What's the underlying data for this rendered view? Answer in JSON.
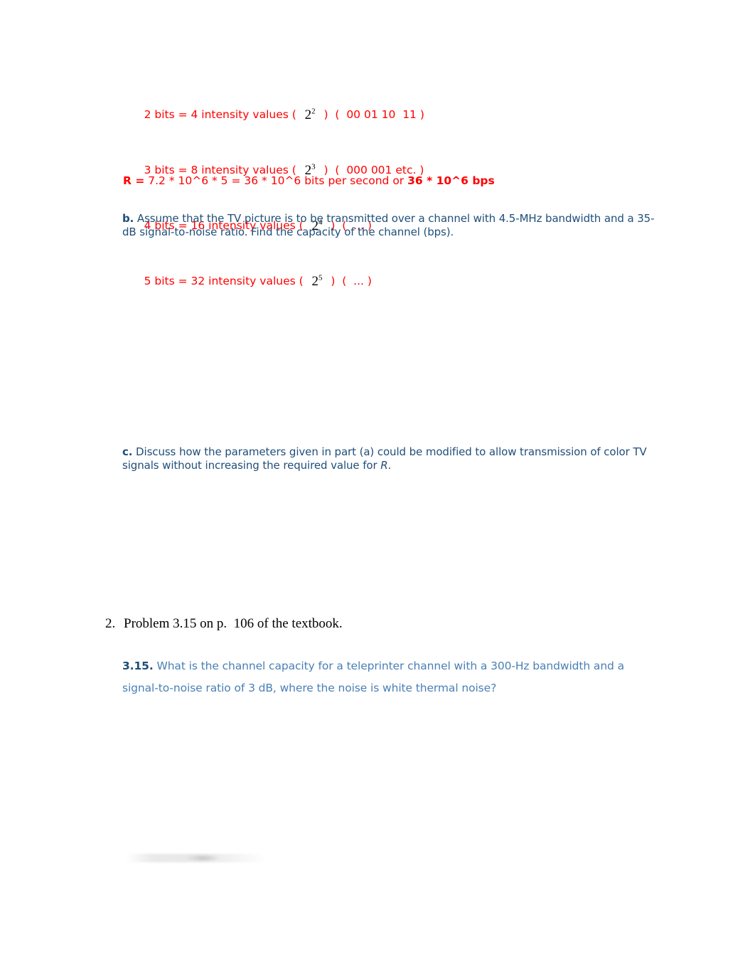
{
  "document": {
    "page_background": "#ffffff",
    "colors": {
      "annotation_red": "#ff0000",
      "textbook_blue_dark": "#1f4e79",
      "textbook_blue_light": "#4a7fb5",
      "body_black": "#000000"
    }
  },
  "red_solution": {
    "lines": [
      {
        "prefix": "2 bits = 4 intensity values (  ",
        "base": "2",
        "exp": "2",
        "suffix": "  )  (  00 01 10  11 )"
      },
      {
        "prefix": "3 bits = 8 intensity values (  ",
        "base": "2",
        "exp": "3",
        "suffix": "  )  (  000 001 etc. )"
      },
      {
        "prefix": "4 bits = 16 intensity values (  ",
        "base": "2",
        "exp": "4",
        "suffix": "  )  (  ... )"
      },
      {
        "prefix": "5 bits = 32 intensity values (  ",
        "base": "2",
        "exp": "5",
        "suffix": "  )  (  ... )"
      }
    ],
    "result": {
      "label": "R =",
      "expression": " 7.2 * 10^6 * 5 = 36 * 10^6 bits per second or ",
      "answer": "36 * 10^6 bps"
    }
  },
  "part_b": {
    "label": "b.",
    "text": " Assume that the TV picture is to be transmitted over a channel with 4.5-MHz bandwidth and a 35-dB signal-to-noise ratio. Find the capacity of the channel (bps)."
  },
  "part_c": {
    "label": "c.",
    "text_before": " Discuss how the parameters given in part (a) could be modified to allow transmission of color TV signals without increasing the required value for ",
    "italic_symbol": "R",
    "text_after": "."
  },
  "item_2": {
    "number": "2.",
    "text": "Problem 3.15 on p.  106 of the textbook."
  },
  "problem_315": {
    "number": "3.15.",
    "text": " What is the channel capacity for a teleprinter channel with a 300-Hz bandwidth and a signal-to-noise ratio of 3 dB, where the noise is white thermal noise?"
  }
}
